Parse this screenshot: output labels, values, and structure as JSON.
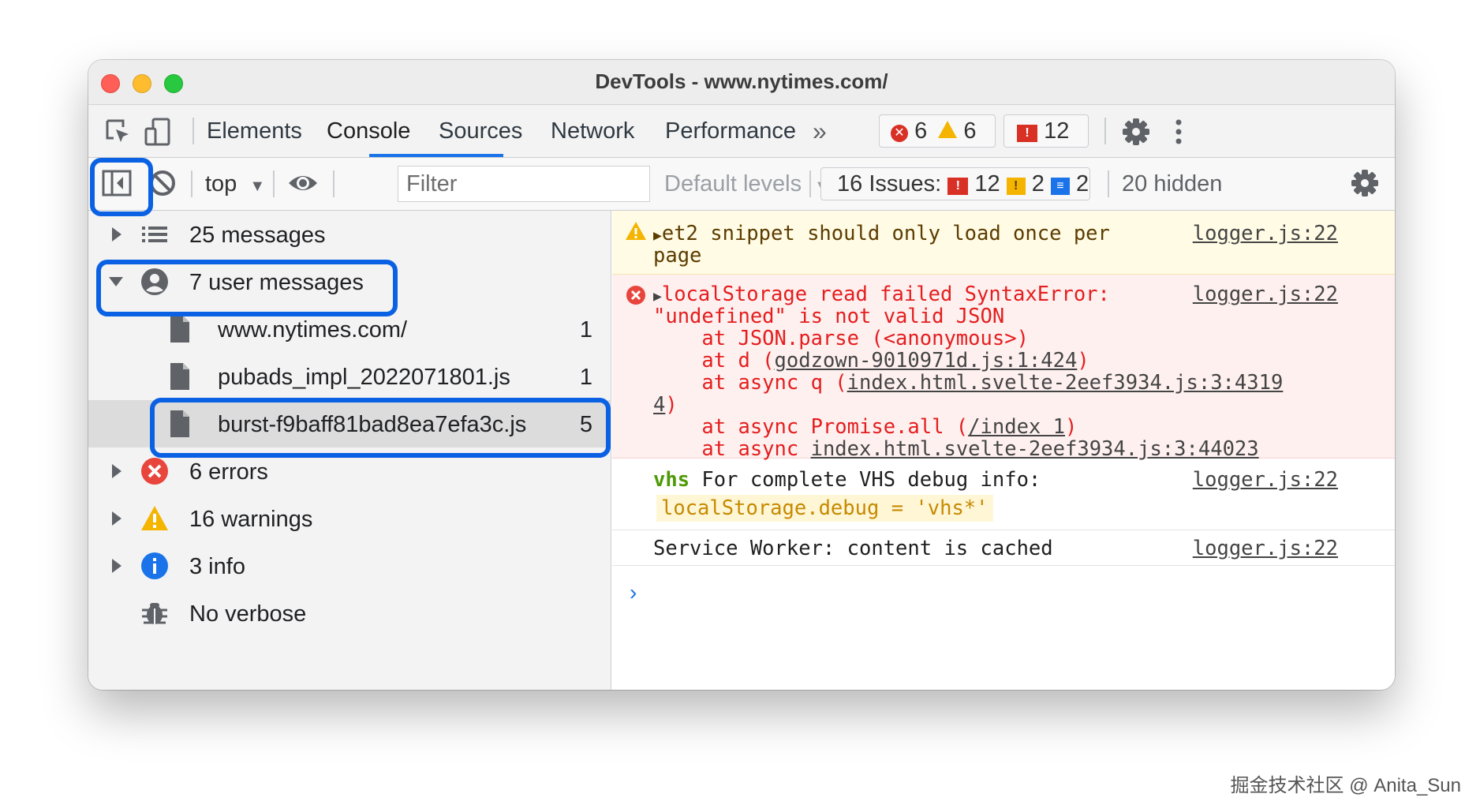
{
  "window": {
    "title": "DevTools - www.nytimes.com/"
  },
  "toolbar": {
    "tabs": [
      {
        "label": "Elements"
      },
      {
        "label": "Console"
      },
      {
        "label": "Sources"
      },
      {
        "label": "Network"
      },
      {
        "label": "Performance"
      }
    ],
    "more_tabs": "»",
    "errors_count": "6",
    "warnings_count": "6",
    "issues_count": "12"
  },
  "console_toolbar": {
    "context": "top",
    "filter_placeholder": "Filter",
    "levels": "Default levels",
    "issues_label": "16 Issues:",
    "issues_red": "12",
    "issues_yellow": "2",
    "issues_blue": "2",
    "hidden": "20 hidden"
  },
  "sidebar": {
    "items": [
      {
        "label": "25 messages"
      },
      {
        "label": "7 user messages"
      },
      {
        "label": "www.nytimes.com/",
        "count": "1"
      },
      {
        "label": "pubads_impl_2022071801.js",
        "count": "1"
      },
      {
        "label": "burst-f9baff81bad8ea7efa3c.js",
        "count": "5"
      },
      {
        "label": "6 errors"
      },
      {
        "label": "16 warnings"
      },
      {
        "label": "3 info"
      },
      {
        "label": "No verbose"
      }
    ]
  },
  "messages": {
    "warn": {
      "line1": "et2 snippet should only load once per",
      "line2": "page",
      "source": "logger.js:22"
    },
    "error": {
      "line1": "localStorage read failed SyntaxError:",
      "line2": "\"undefined\" is not valid JSON",
      "line3": "    at JSON.parse (<anonymous>)",
      "line4_pre": "    at d (",
      "line4_link": "godzown-9010971d.js:1:424",
      "line4_post": ")",
      "line5_pre": "    at async q (",
      "line5_link": "index.html.svelte-2eef3934.js:3:4319",
      "line6_link": "4",
      "line6_post": ")",
      "line7_pre": "    at async Promise.all (",
      "line7_link": "/index 1",
      "line7_post": ")",
      "line8_pre": "    at async ",
      "line8_link": "index.html.svelte-2eef3934.js:3:44023",
      "source": "logger.js:22"
    },
    "vhs": {
      "tag": "vhs",
      "text": " For complete VHS debug info:",
      "code": "localStorage.debug = 'vhs*'",
      "source": "logger.js:22"
    },
    "sw": {
      "text": "Service Worker: content is cached",
      "source": "logger.js:22"
    },
    "prompt": "›"
  },
  "watermark": "掘金技术社区 @ Anita_Sun",
  "colors": {
    "accent": "#1a73e8",
    "highlight": "#0b61e3",
    "error": "#d93025",
    "warning": "#f4b400"
  }
}
